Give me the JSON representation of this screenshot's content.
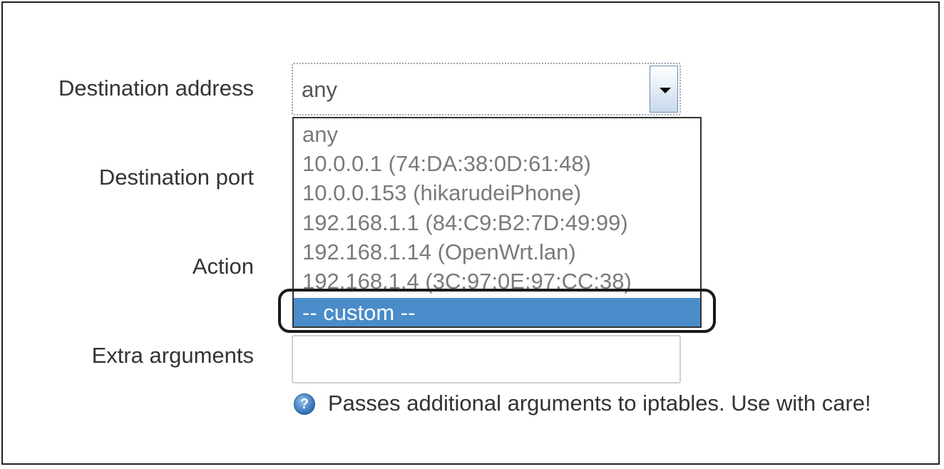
{
  "form": {
    "destination_address_label": "Destination address",
    "destination_port_label": "Destination port",
    "action_label": "Action",
    "extra_arguments_label": "Extra arguments"
  },
  "destination_select": {
    "value": "any",
    "options": [
      "any",
      "10.0.0.1 (74:DA:38:0D:61:48)",
      "10.0.0.153 (hikarudeiPhone)",
      "192.168.1.1 (84:C9:B2:7D:49:99)",
      "192.168.1.14 (OpenWrt.lan)",
      "192.168.1.4 (3C:97:0E:97:CC:38)",
      "-- custom --"
    ],
    "highlighted_option": "-- custom --"
  },
  "extra_arguments": {
    "value": "",
    "help_text": "Passes additional arguments to iptables. Use with care!",
    "help_icon": "question-icon"
  },
  "colors": {
    "highlight": "#4a8cc9",
    "option_text": "#7a7a7a",
    "label_text": "#333333"
  }
}
